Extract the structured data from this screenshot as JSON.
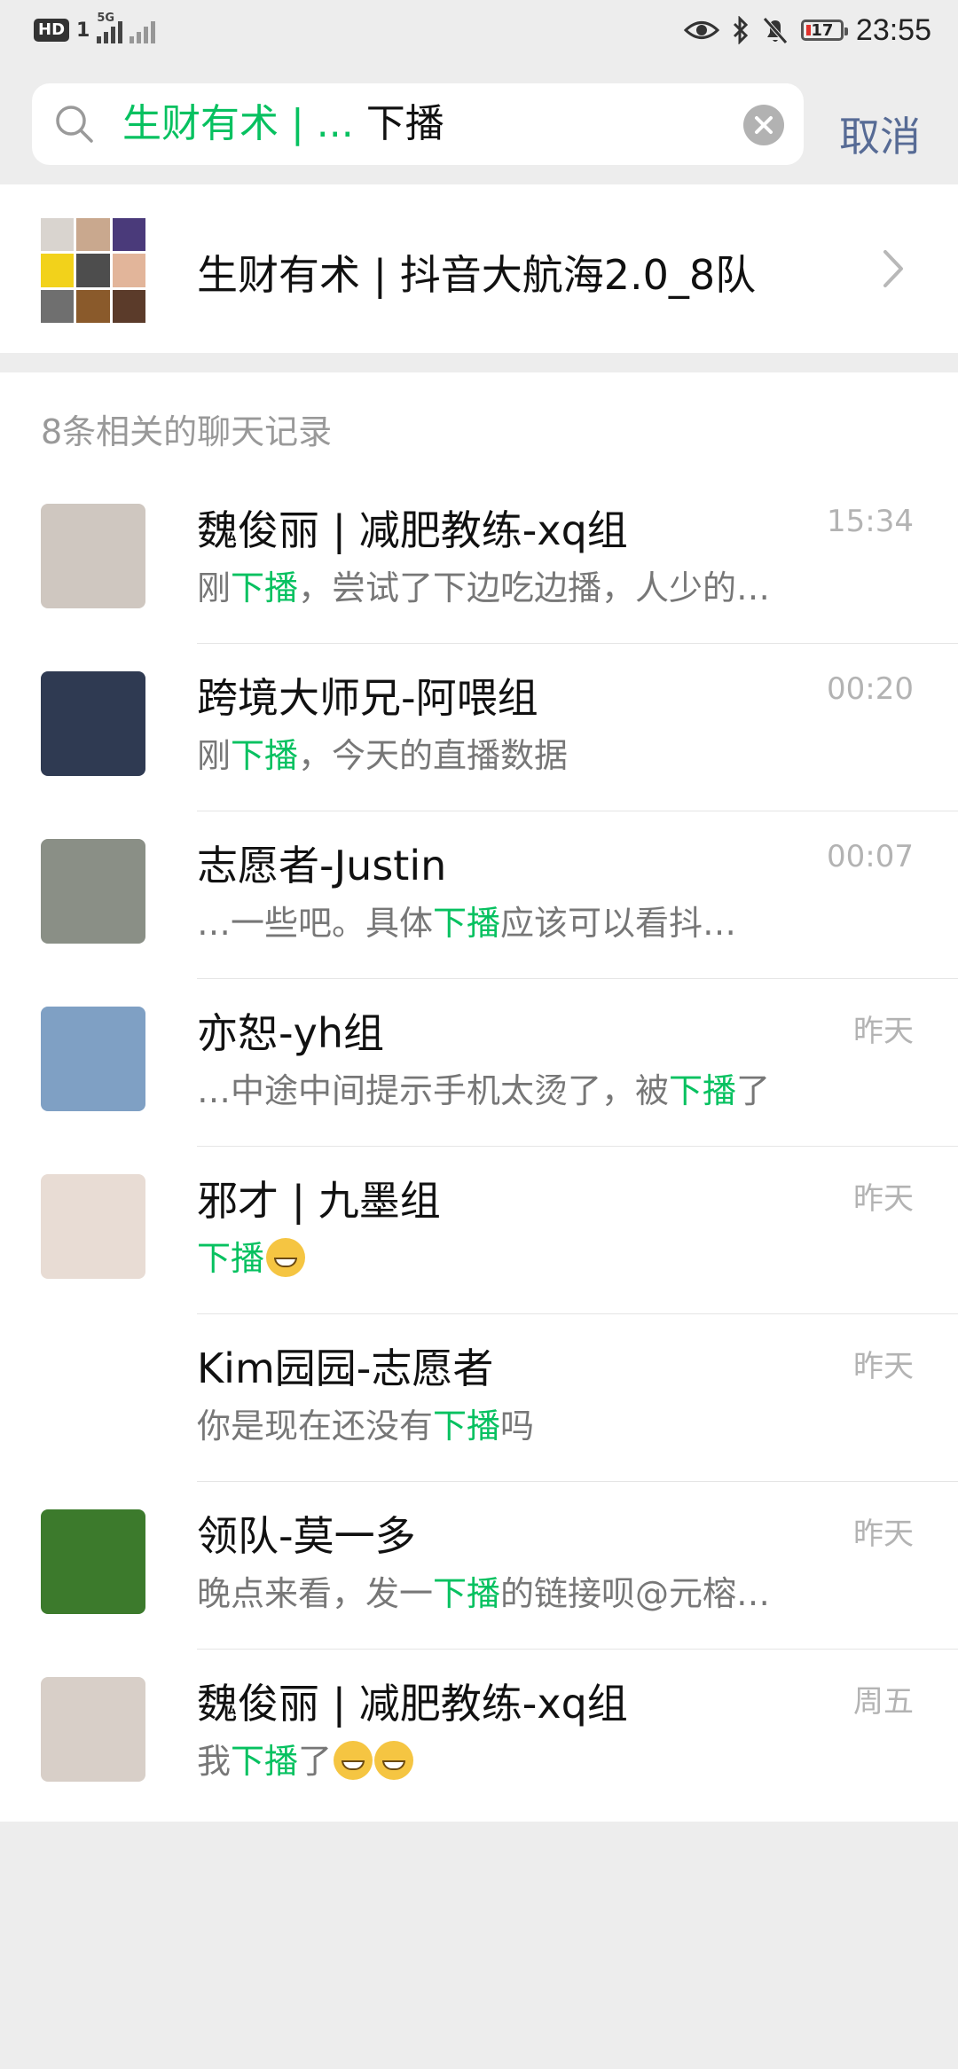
{
  "status_bar": {
    "hd": "HD",
    "sim": "1",
    "net": "5G",
    "time": "23:55",
    "battery": "17"
  },
  "search": {
    "query_highlight": "生财有术 | ...",
    "query_rest": " 下播",
    "cancel_label": "取消"
  },
  "group": {
    "name": "生财有术 | 抖音大航海2.0_8队"
  },
  "results": {
    "title": "8条相关的聊天记录",
    "items": [
      {
        "name": "魏俊丽 | 减肥教练-xq组",
        "time": "15:34",
        "pre": "刚",
        "hl": "下播",
        "post": "，尝试了下边吃边播，人少的…",
        "emoji": 0,
        "avatar_color": "#cfc7c0"
      },
      {
        "name": "跨境大师兄-阿喂组",
        "time": "00:20",
        "pre": "刚",
        "hl": "下播",
        "post": "，今天的直播数据",
        "emoji": 0,
        "avatar_color": "#2f3a52"
      },
      {
        "name": "志愿者-Justin",
        "time": "00:07",
        "pre": "…一些吧。具体",
        "hl": "下播",
        "post": "应该可以看抖…",
        "emoji": 0,
        "avatar_color": "#8a8f86"
      },
      {
        "name": "亦恕-yh组",
        "time": "昨天",
        "pre": "…中途中间提示手机太烫了，被",
        "hl": "下播",
        "post": "了",
        "emoji": 0,
        "avatar_color": "#7fa0c4"
      },
      {
        "name": "邪才 | 九墨组",
        "time": "昨天",
        "pre": "",
        "hl": "下播",
        "post": "",
        "emoji": 1,
        "avatar_color": "#e8dcd4"
      },
      {
        "name": "Kim园园-志愿者",
        "time": "昨天",
        "pre": "你是现在还没有",
        "hl": "下播",
        "post": "吗",
        "emoji": 0,
        "avatar_color": "#ffffff"
      },
      {
        "name": "领队-莫一多",
        "time": "昨天",
        "pre": "晚点来看，发一",
        "hl": "下播",
        "post": "的链接呗@元榕…",
        "emoji": 0,
        "avatar_color": "#3c7a2c"
      },
      {
        "name": "魏俊丽 | 减肥教练-xq组",
        "time": "周五",
        "pre": "我",
        "hl": "下播",
        "post": "了",
        "emoji": 2,
        "avatar_color": "#d8cfc8"
      }
    ]
  },
  "colors": {
    "accent": "#07c160",
    "link": "#576b95",
    "background": "#ededed"
  },
  "icons": {
    "search": "search-icon",
    "clear": "clear-icon",
    "chevron": "chevron-right-icon"
  }
}
